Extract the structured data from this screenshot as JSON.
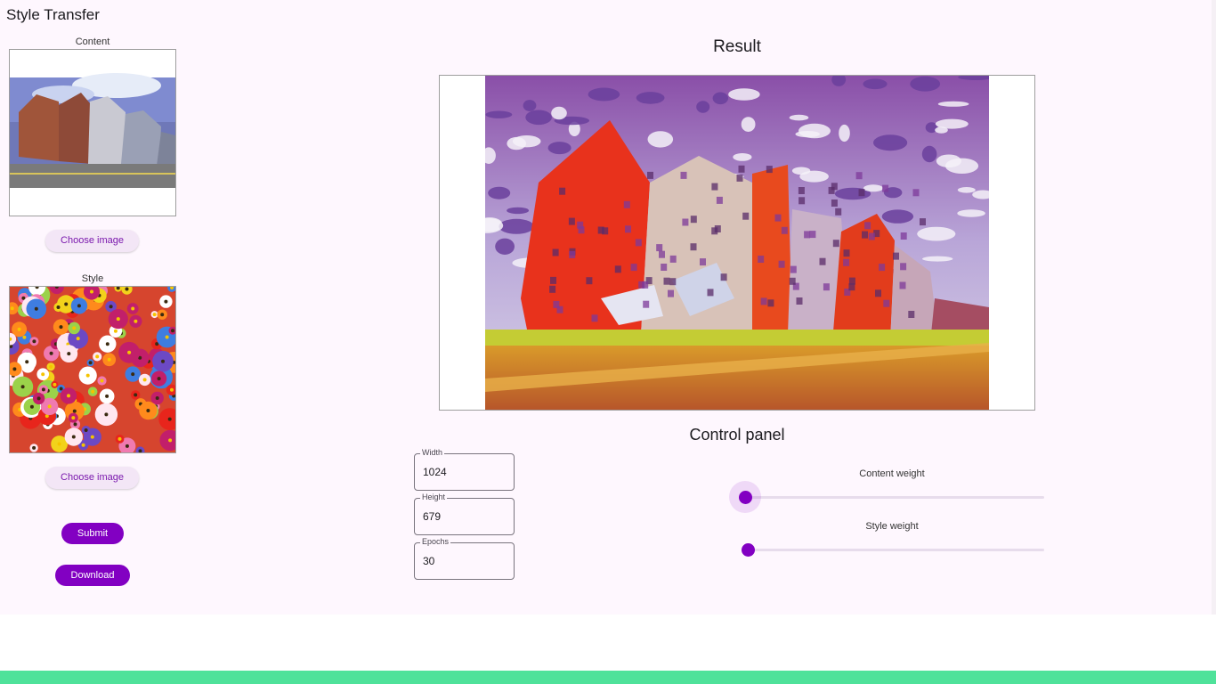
{
  "app": {
    "title": "Style Transfer"
  },
  "content": {
    "label": "Content",
    "choose_button": "Choose image"
  },
  "style": {
    "label": "Style",
    "choose_button": "Choose image"
  },
  "actions": {
    "submit": "Submit",
    "download": "Download"
  },
  "result": {
    "title": "Result"
  },
  "control_panel": {
    "title": "Control panel",
    "width": {
      "label": "Width",
      "value": "1024"
    },
    "height": {
      "label": "Height",
      "value": "679"
    },
    "epochs": {
      "label": "Epochs",
      "value": "30"
    },
    "content_weight": {
      "label": "Content weight",
      "value_fraction": 0.0
    },
    "style_weight": {
      "label": "Style weight",
      "value_fraction": 0.0
    }
  },
  "colors": {
    "accent": "#8200c2",
    "tonal_button_bg": "#f3e6f6",
    "background": "#fef7fe",
    "bottom_bar": "#4fe29a"
  }
}
